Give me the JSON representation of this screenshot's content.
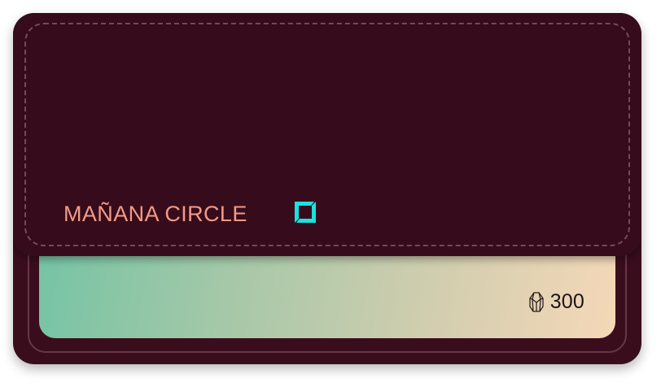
{
  "wallet": {
    "circle_name": "MAÑANA CIRCLE",
    "brand_icon": "square-bracket-logo-icon",
    "accent_color": "#19e3e0",
    "name_color": "#f39a86",
    "leather_color": "#360c1c"
  },
  "card": {
    "points_icon": "gem-icon",
    "points_value": "300",
    "gradient_colors": [
      "#74c4a5",
      "#f5d8b8"
    ]
  }
}
